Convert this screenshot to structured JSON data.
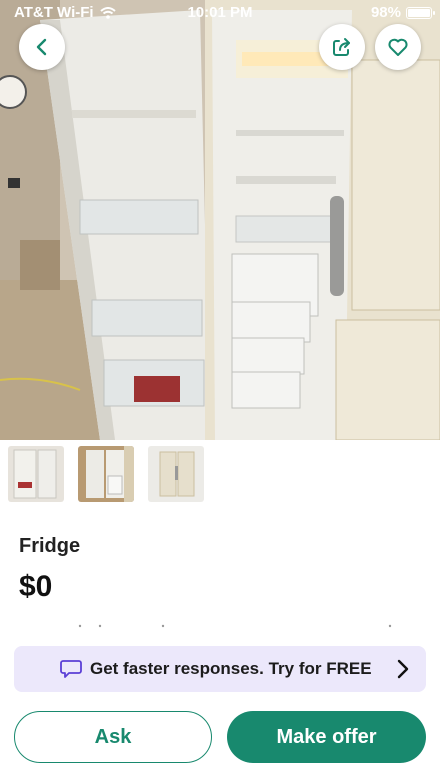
{
  "status_bar": {
    "carrier": "AT&T Wi-Fi",
    "time": "10:01 PM",
    "battery_percent": "98%",
    "battery_level": 0.98
  },
  "icons": {
    "back": "chevron-left-icon",
    "share": "share-icon",
    "favorite": "heart-icon",
    "promo": "chat-bubble-icon",
    "promo_arrow": "chevron-right-icon"
  },
  "listing": {
    "title": "Fridge",
    "price": "$0",
    "thumbnails": [
      {
        "name": "photo-1",
        "selected": false
      },
      {
        "name": "photo-2",
        "selected": true
      },
      {
        "name": "photo-3",
        "selected": false
      }
    ]
  },
  "promo": {
    "text": "Get faster responses. Try for FREE"
  },
  "actions": {
    "ask_label": "Ask",
    "offer_label": "Make offer"
  },
  "colors": {
    "accent": "#18896e",
    "promo_bg": "#ece8fb"
  }
}
